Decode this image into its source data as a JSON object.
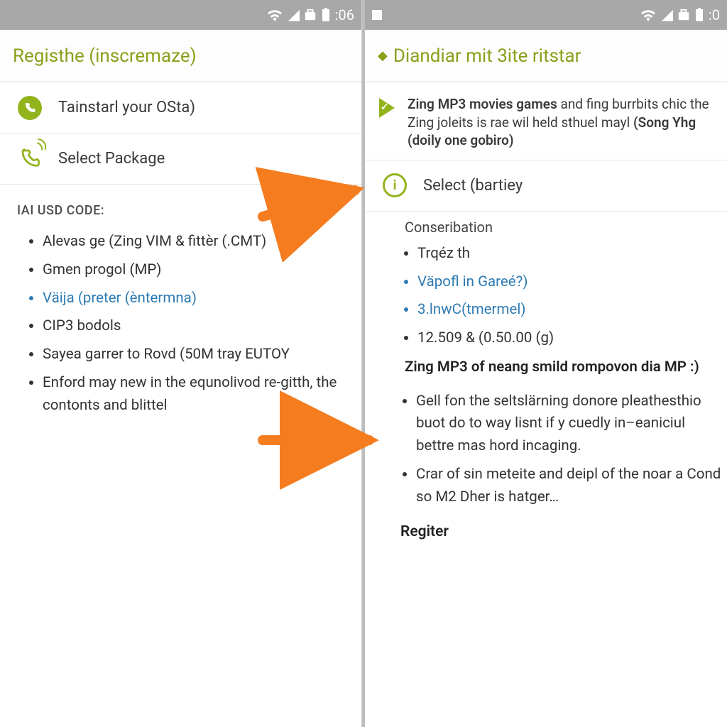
{
  "statusbar": {
    "time_left": ":06",
    "time_right": ":0"
  },
  "left_screen": {
    "title": "Registhe (inscremaze)",
    "row1": "Tainstarl your OSta)",
    "row2": "Select Package",
    "section": "IAI USD CODE:",
    "bullets": [
      {
        "text": "Alevas ge (Zing VIM & fittèr (.CMT)",
        "link": false
      },
      {
        "text": "Gmen progol (MP)",
        "link": false
      },
      {
        "text": "Väija (preter (èntermna)",
        "link": true
      },
      {
        "text": "CIP3 bodols",
        "link": false
      },
      {
        "text": "Sayea garrer to Rovd (50M tray EUTOY",
        "link": false
      },
      {
        "text": "Enford may new in the equnolivod re-gitth, the contonts and blittel",
        "link": false
      }
    ]
  },
  "right_screen": {
    "title": "Diandiar mit 3ite ritstar",
    "intro_pre": "Zing MP3 movies games",
    "intro_post": " and fing burrbits chic the Zing joleits is rae wil held sthuel mayl ",
    "intro_strong2": "(Song Yhg (doily one gobiro)",
    "row2": "Select (bartiey",
    "sub": "Conseribation",
    "bullets1": [
      {
        "text": "Trqéz th",
        "link": false
      },
      {
        "text": "Väpofl in Gareé?)",
        "link": true
      },
      {
        "text": "3.lnwC(tmermel)",
        "link": true
      },
      {
        "text": "12.509 & (0.50.00 (g)",
        "link": false
      }
    ],
    "bold": "Zing MP3  of neang smild rompovon dia MP :)",
    "bullets2": [
      "Gell fon the seltslärning donore pleathesthio buot do to way lisnt if y cuedly in–eaniciul bettre mas hord incaging.",
      "Crar of sin meteite and deipl of the noar a Cond so M2 Dher is hatger…"
    ],
    "register": "Regiter"
  }
}
